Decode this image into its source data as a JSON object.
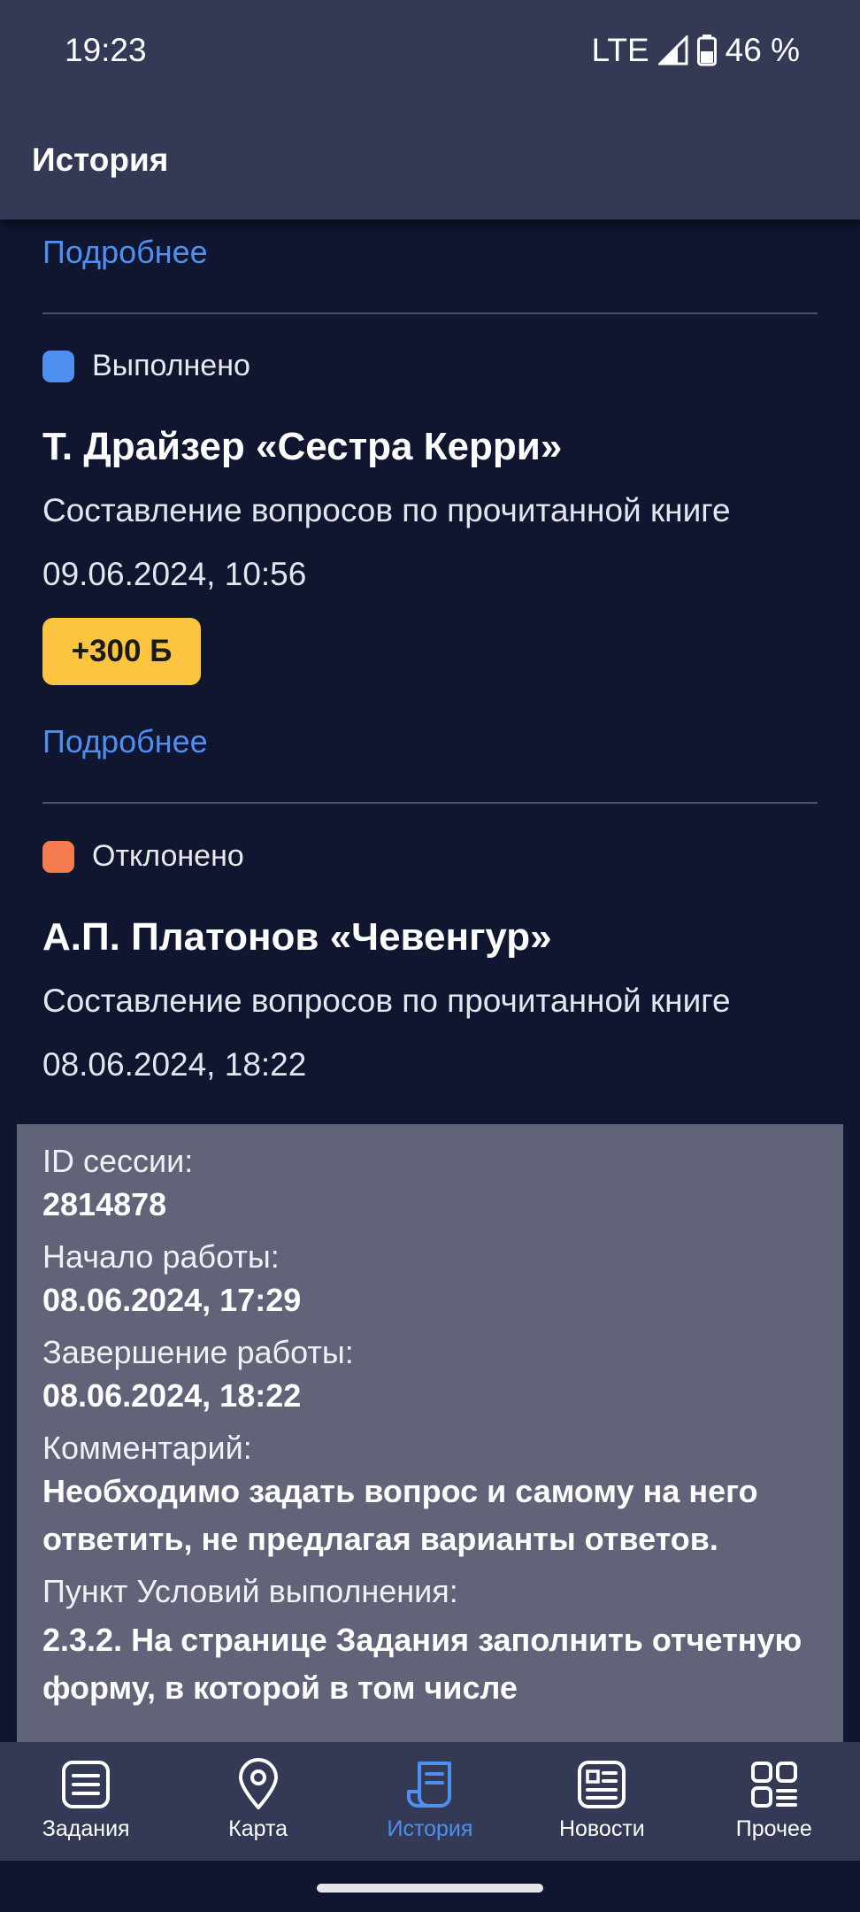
{
  "status_bar": {
    "time": "19:23",
    "network": "LTE",
    "battery": "46 %"
  },
  "app_bar": {
    "title": "История"
  },
  "history": {
    "top_link": "Подробнее",
    "items": [
      {
        "status": "Выполнено",
        "status_color": "#4f8ff0",
        "title": "Т. Драйзер «Сестра Керри»",
        "description": "Составление вопросов по прочитанной книге",
        "date": "09.06.2024, 10:56",
        "points": "+300 Б",
        "link": "Подробнее"
      },
      {
        "status": "Отклонено",
        "status_color": "#f47a4f",
        "title": "А.П. Платонов «Чевенгур»",
        "description": "Составление вопросов по прочитанной книге",
        "date": "08.06.2024, 18:22",
        "details": {
          "session_label": "ID сессии:",
          "session_value": "2814878",
          "start_label": "Начало работы:",
          "start_value": "08.06.2024, 17:29",
          "end_label": "Завершение работы:",
          "end_value": "08.06.2024, 18:22",
          "comment_label": "Комментарий:",
          "comment_value": "Необходимо задать вопрос и самому на него ответить, не предлагая варианты ответов.",
          "clause_label": "Пункт Условий выполнения:",
          "clause_value": "2.3.2. На странице Задания заполнить отчетную форму, в которой в том числе"
        }
      }
    ]
  },
  "bottom_nav": {
    "items": [
      {
        "label": "Задания",
        "icon": "tasks-icon"
      },
      {
        "label": "Карта",
        "icon": "map-pin-icon"
      },
      {
        "label": "История",
        "icon": "history-icon",
        "active": true
      },
      {
        "label": "Новости",
        "icon": "news-icon"
      },
      {
        "label": "Прочее",
        "icon": "more-grid-icon"
      }
    ]
  },
  "colors": {
    "background": "#101530",
    "bars": "#343a55",
    "accent": "#4f8ff0",
    "badge": "#fcc441",
    "details_panel": "#616478"
  }
}
